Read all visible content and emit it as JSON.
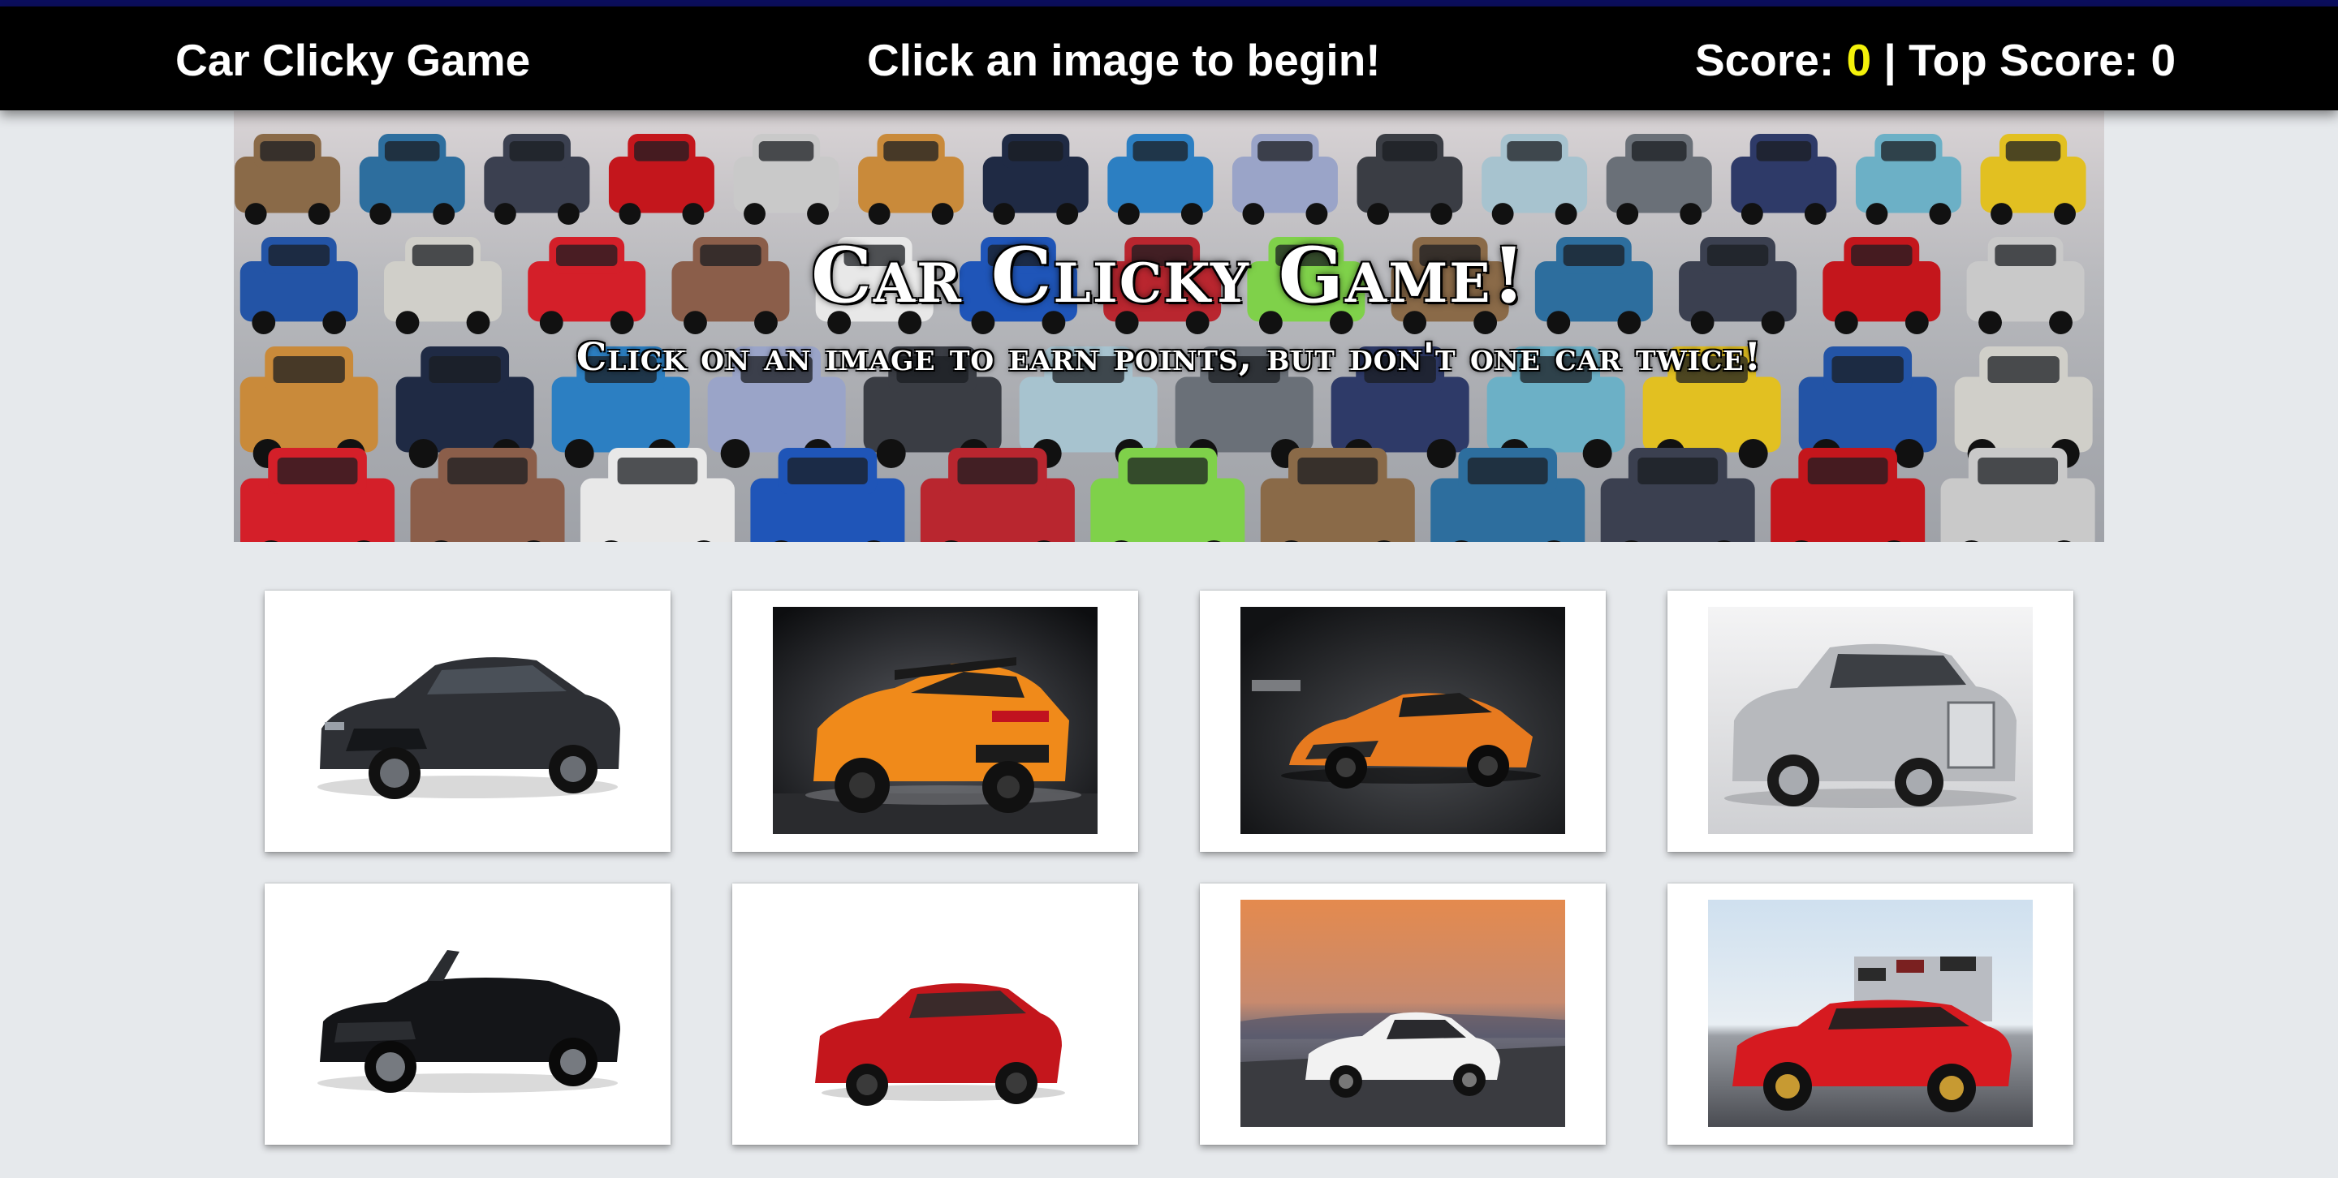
{
  "navbar": {
    "brand": "Car Clicky Game",
    "message": "Click an image to begin!",
    "score_label": "Score: ",
    "score": "0",
    "separator": " | ",
    "top_score_label": "Top Score: ",
    "top_score": "0"
  },
  "hero": {
    "title": "Car Clicky Game!",
    "subtitle": "Click on an image to earn points, but don't one car twice!"
  },
  "colors": {
    "navbar_bg": "#000000",
    "top_stripe": "#0b0e5e",
    "score_accent": "#f4f20a",
    "page_bg": "#e6e9ec"
  },
  "cards": [
    {
      "name": "dark-gray-camaro",
      "body_color": "#2e3035",
      "background": "white"
    },
    {
      "name": "orange-corvette",
      "body_color": "#f08a1a",
      "background": "dark"
    },
    {
      "name": "orange-mclaren",
      "body_color": "#e77a1f",
      "background": "dark"
    },
    {
      "name": "silver-rolls-royce",
      "body_color": "#b7b9bd",
      "background": "light"
    },
    {
      "name": "black-mustang-convertible",
      "body_color": "#141518",
      "background": "white"
    },
    {
      "name": "red-nissan-gtr",
      "body_color": "#c4161c",
      "background": "white"
    },
    {
      "name": "white-alfa-romeo",
      "body_color": "#f2f2f2",
      "background": "sunset"
    },
    {
      "name": "red-dodge-challenger",
      "body_color": "#d61a20",
      "background": "track"
    }
  ]
}
